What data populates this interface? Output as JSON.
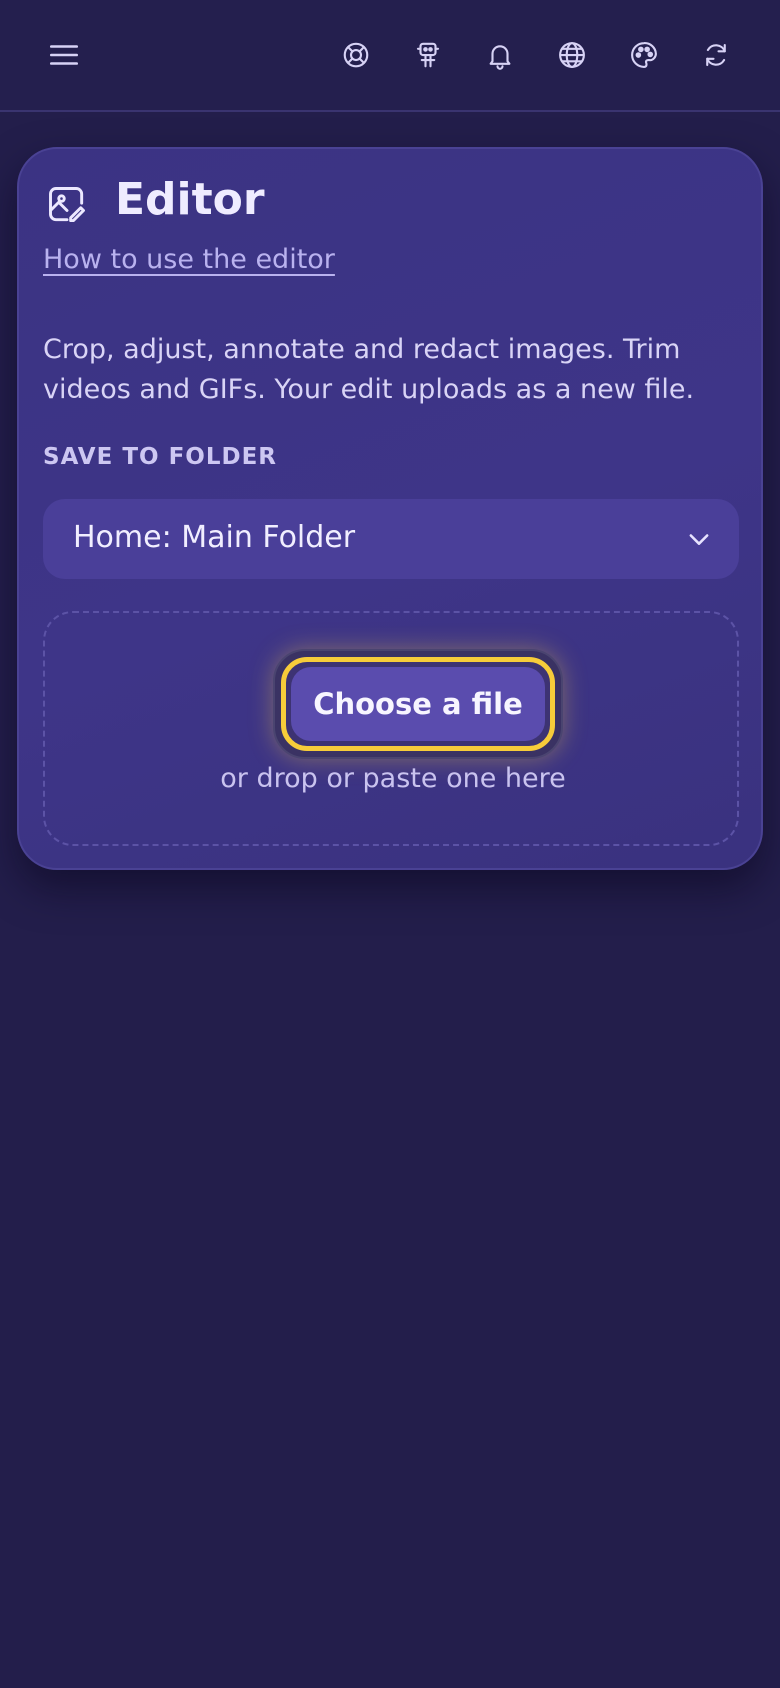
{
  "topbar": {
    "icons": [
      "menu-icon",
      "lifebuoy-icon",
      "robot-icon",
      "bell-icon",
      "globe-icon",
      "palette-icon",
      "refresh-icon"
    ]
  },
  "editor": {
    "title": "Editor",
    "help_link": "How to use the editor",
    "description": "Crop, adjust, annotate and redact images. Trim videos and GIFs. Your edit uploads as a new file.",
    "save_label": "SAVE TO FOLDER",
    "folder_value": "Home: Main Folder",
    "choose_button": "Choose a file",
    "drop_hint": "or drop or paste one here"
  },
  "colors": {
    "background": "#231e4b",
    "card": "#3d3487",
    "accent_focus": "#f7cc3a",
    "button": "#5a4cae"
  }
}
